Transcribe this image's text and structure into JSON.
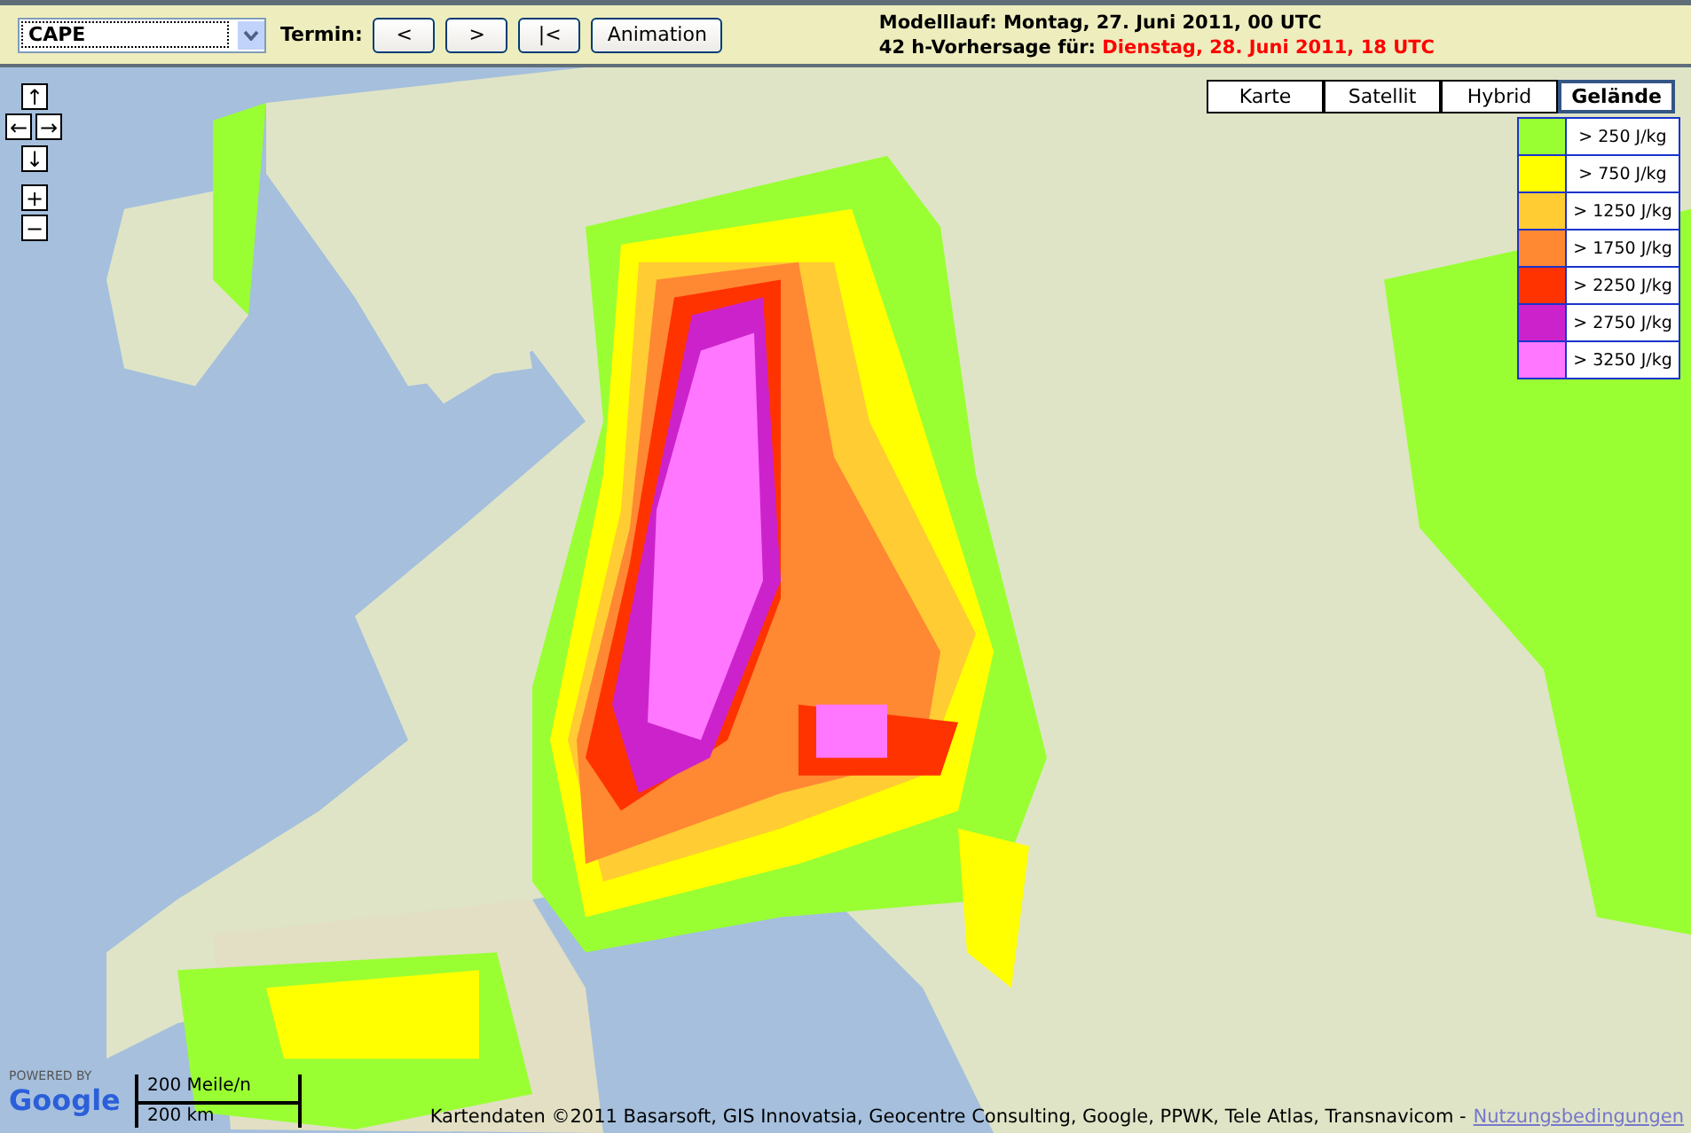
{
  "toolbar": {
    "parameter_select": {
      "value": "CAPE"
    },
    "termin_label": "Termin:",
    "buttons": [
      {
        "label": "<"
      },
      {
        "label": ">"
      },
      {
        "label": "|<"
      },
      {
        "label": "Animation"
      }
    ]
  },
  "run_info": {
    "model_run": "Modelllauf: Montag, 27. Juni 2011, 00 UTC",
    "forecast_prefix": "42 h-Vorhersage für:",
    "forecast_time": "Dienstag, 28. Juni 2011, 18 UTC"
  },
  "map": {
    "nav_controls": [
      {
        "symbol": "↑",
        "kind": "up"
      },
      {
        "symbol": "←",
        "kind": "left"
      },
      {
        "symbol": "→",
        "kind": "right"
      },
      {
        "symbol": "↓",
        "kind": "down"
      },
      {
        "symbol": "+",
        "kind": "zoom-in"
      },
      {
        "symbol": "−",
        "kind": "zoom-out"
      }
    ],
    "map_types": [
      {
        "label": "Karte",
        "selected": false
      },
      {
        "label": "Satellit",
        "selected": false
      },
      {
        "label": "Hybrid",
        "selected": false
      },
      {
        "label": "Gelände",
        "selected": true
      }
    ],
    "legend": [
      {
        "label": "> 250 J/kg",
        "color": "#99ff33"
      },
      {
        "label": "> 750 J/kg",
        "color": "#ffff00"
      },
      {
        "label": "> 1250 J/kg",
        "color": "#ffcc33"
      },
      {
        "label": "> 1750 J/kg",
        "color": "#ff8833"
      },
      {
        "label": "> 2250 J/kg",
        "color": "#ff3300"
      },
      {
        "label": "> 2750 J/kg",
        "color": "#cc22cc"
      },
      {
        "label": "> 3250 J/kg",
        "color": "#ff77ff"
      }
    ],
    "powered_by": "POWERED BY",
    "logo": "Google",
    "scale": {
      "imperial": "200 Meile/n",
      "metric": "200 km"
    },
    "attribution": "Kartendaten ©2011 Basarsoft, GIS Innovatsia, Geocentre Consulting, Google, PPWK, Tele Atlas, Transnavicom -",
    "terms_link": "Nutzungsbedingungen"
  }
}
